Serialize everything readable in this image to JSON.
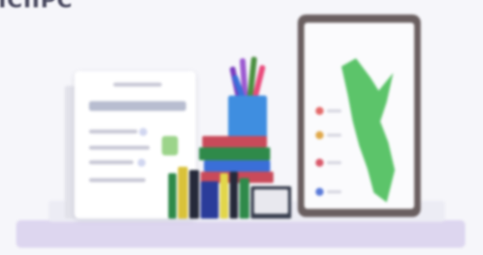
{
  "heading": {
    "text": "ICIIPC"
  },
  "colors": {
    "background": "#f6f6fa",
    "shelf": "#ddd6ef",
    "cup": "#3f8ee0",
    "tablet_frame": "#6a5f60",
    "map_green": "#5cc46a"
  },
  "illustration": {
    "books": [
      "#2f8a4a",
      "#d9c23a",
      "#2a3c9a",
      "#e2d64a",
      "#262a3a",
      "#c94a5a",
      "#e8e8ee"
    ],
    "pencils": [
      "#7a3bbf",
      "#e94a7a",
      "#4a8f3f",
      "#9b59d0",
      "#3a6fd8"
    ],
    "legend_dots": [
      "#e46a6a",
      "#e0a84a",
      "#d9596b",
      "#5a7ad9"
    ]
  }
}
